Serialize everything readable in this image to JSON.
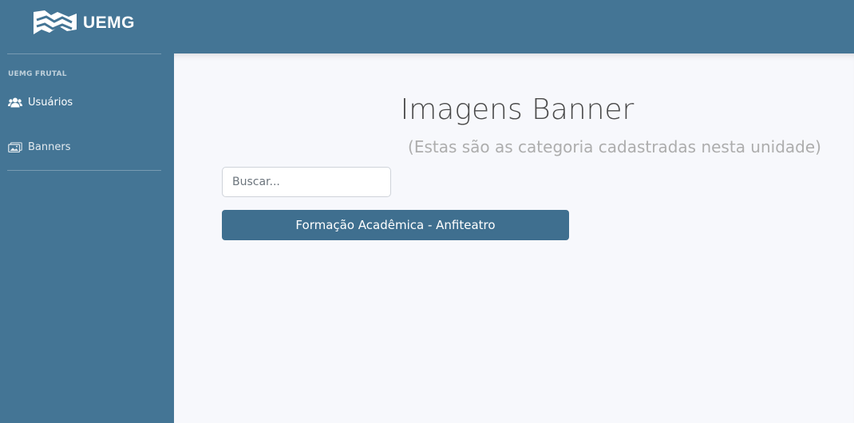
{
  "brand": {
    "name": "UEMG",
    "logo_icon": "uemg-wave-logo-icon"
  },
  "sidebar": {
    "section_heading": "UEMG FRUTAL",
    "items": [
      {
        "label": "Usuários",
        "icon": "users-icon"
      },
      {
        "label": "Banners",
        "icon": "images-icon"
      }
    ]
  },
  "main": {
    "title": "Imagens Banner",
    "subtitle": "(Estas são as categoria cadastradas nesta unidade)",
    "search": {
      "placeholder": "Buscar...",
      "value": ""
    },
    "categories": [
      {
        "label": "Formação Acadêmica - Anfiteatro"
      }
    ]
  },
  "colors": {
    "sidebar": "#447595",
    "button": "#3f6f8f",
    "background": "#f7f8fc"
  }
}
